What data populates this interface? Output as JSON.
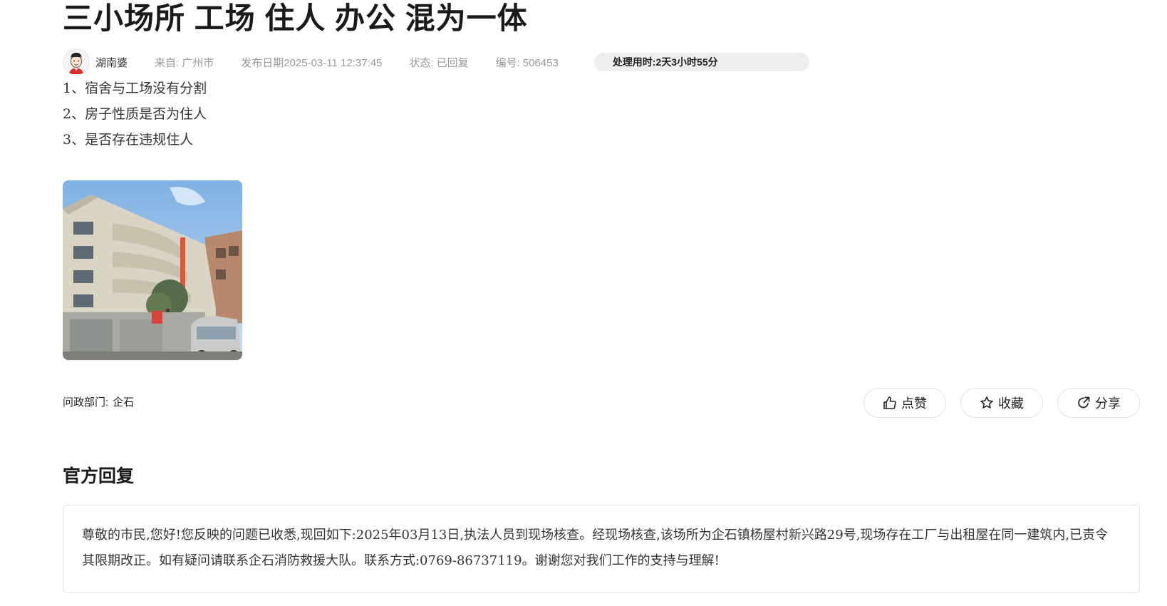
{
  "post": {
    "title": "三小场所 工场 住人 办公 混为一体",
    "author": "湖南婆",
    "from_label": "来自:",
    "from_value": "广州市",
    "date_label": "发布日期",
    "date_value": "2025-03-11 12:37:45",
    "status_label": "状态:",
    "status_value": "已回复",
    "id_label": "编号:",
    "id_value": "506453",
    "duration_label": "处理用时:",
    "duration_value": "2天3小时55分",
    "content_lines": [
      "1、宿舍与工场没有分割",
      "2、房子性质是否为住人",
      "3、是否存在违规住人"
    ],
    "dept_label": "问政部门:",
    "dept_value": "企石"
  },
  "actions": {
    "like_label": "点赞",
    "favorite_label": "收藏",
    "share_label": "分享"
  },
  "reply": {
    "section_title": "官方回复",
    "text": "尊敬的市民,您好!您反映的问题已收悉,现回如下:2025年03月13日,执法人员到现场核查。经现场核查,该场所为企石镇杨屋村新兴路29号,现场存在工厂与出租屋在同一建筑内,已责令其限期改正。如有疑问请联系企石消防救援大队。联系方式:0769-86737119。谢谢您对我们工作的支持与理解!"
  },
  "icons": {
    "avatar": "cartoon-avatar-icon",
    "like": "thumbs-up-icon",
    "favorite": "star-icon",
    "share": "share-icon"
  },
  "colors": {
    "meta_text": "#999999",
    "duration_bg": "#eeeeee",
    "border": "#e6e6e6"
  }
}
